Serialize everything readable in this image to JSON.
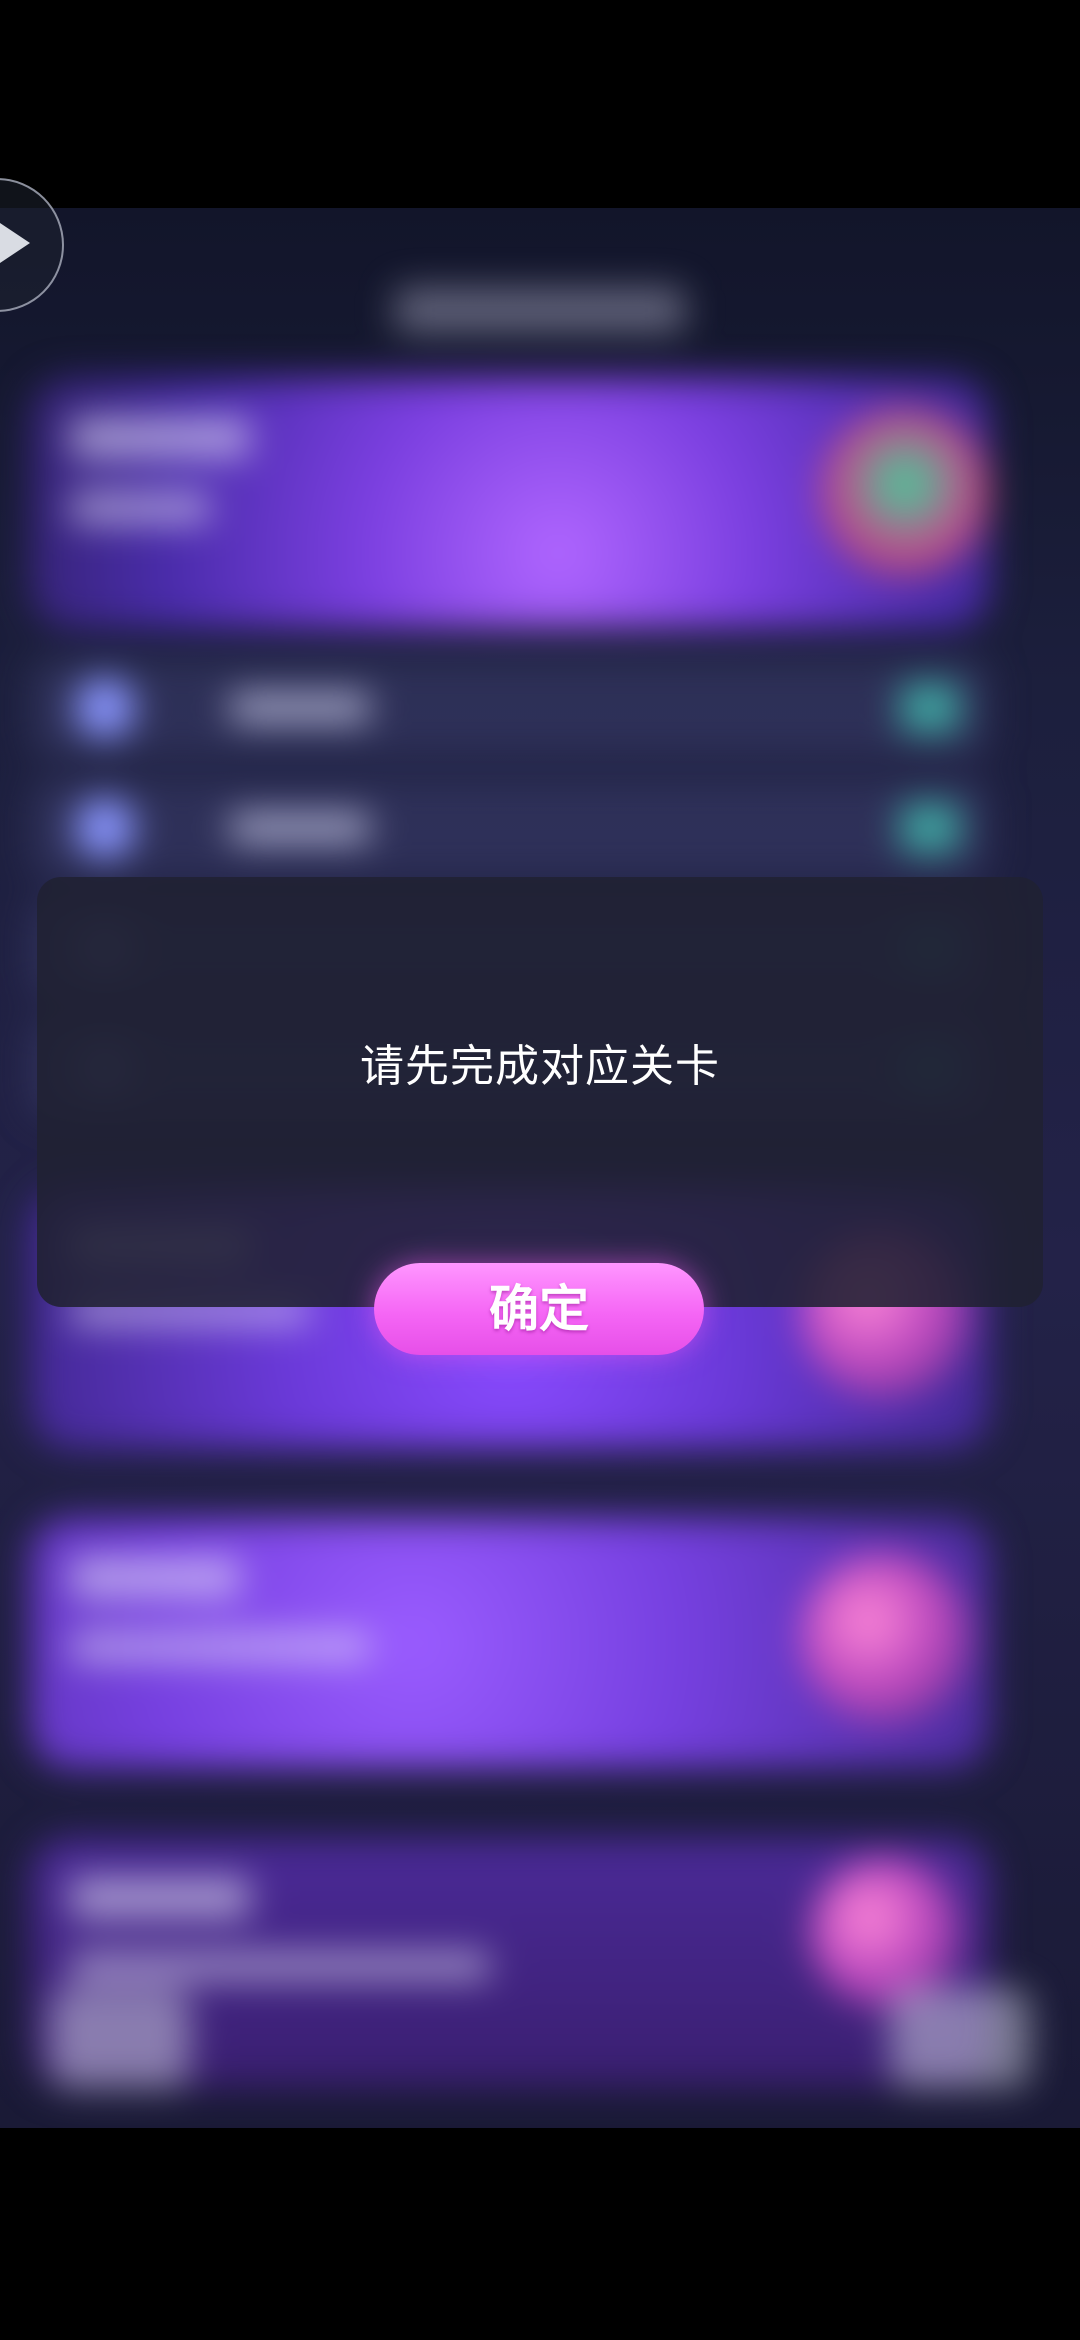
{
  "dialog": {
    "message": "请先完成对应关卡",
    "confirm_label": "确定"
  },
  "floating_button": {
    "icon": "play-icon"
  },
  "colors": {
    "dialog_background": "#202132",
    "confirm_button": "#f566f5",
    "message_text": "#ffffff"
  }
}
